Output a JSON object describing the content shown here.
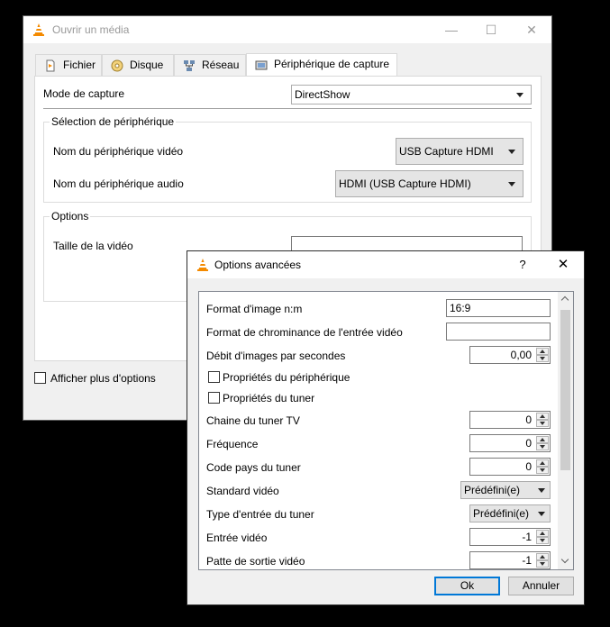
{
  "main_window": {
    "title": "Ouvrir un média",
    "controls": {
      "minimize": "—",
      "maximize": "☐",
      "close": "✕"
    },
    "tabs": [
      {
        "label": "Fichier",
        "icon": "file-icon"
      },
      {
        "label": "Disque",
        "icon": "disc-icon"
      },
      {
        "label": "Réseau",
        "icon": "network-icon"
      },
      {
        "label": "Périphérique de capture",
        "icon": "capture-device-icon"
      }
    ],
    "capture_mode": {
      "label": "Mode de capture",
      "value": "DirectShow"
    },
    "device_selection": {
      "title": "Sélection de périphérique",
      "video_label": "Nom du périphérique vidéo",
      "video_value": "USB Capture HDMI",
      "audio_label": "Nom du périphérique audio",
      "audio_value": "HDMI (USB Capture HDMI)"
    },
    "options": {
      "title": "Options",
      "video_size_label": "Taille de la vidéo",
      "video_size_value": ""
    },
    "show_more_options": "Afficher plus d'options"
  },
  "advanced_dialog": {
    "title": "Options avancées",
    "help": "?",
    "close": "✕",
    "fields": {
      "aspect_label": "Format d'image n:m",
      "aspect_value": "16:9",
      "chroma_label": "Format de chrominance de l'entrée vidéo",
      "chroma_value": "",
      "fps_label": "Débit d'images par secondes",
      "fps_value": "0,00",
      "device_props_label": "Propriétés du périphérique",
      "tuner_props_label": "Propriétés du tuner",
      "tv_channel_label": "Chaine du tuner TV",
      "tv_channel_value": "0",
      "frequency_label": "Fréquence",
      "frequency_value": "0",
      "country_label": "Code pays du tuner",
      "country_value": "0",
      "video_standard_label": "Standard vidéo",
      "video_standard_value": "Prédéfini(e)",
      "tuner_input_label": "Type d'entrée du tuner",
      "tuner_input_value": "Prédéfini(e)",
      "video_input_label": "Entrée vidéo",
      "video_input_value": "-1",
      "video_output_label": "Patte de sortie vidéo",
      "video_output_value": "-1"
    },
    "ok_label": "Ok",
    "cancel_label": "Annuler"
  },
  "colors": {
    "vlc_orange": "#f48a00",
    "accent_blue": "#0078d7"
  }
}
